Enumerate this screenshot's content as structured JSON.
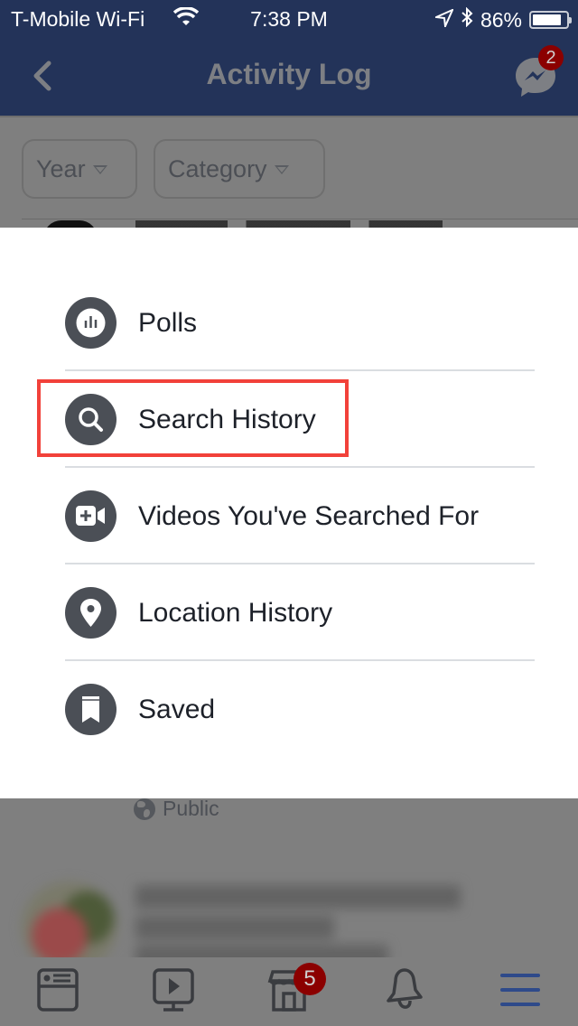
{
  "status_bar": {
    "carrier": "T-Mobile Wi-Fi",
    "time": "7:38 PM",
    "battery": "86%",
    "battery_level": 0.86,
    "icons": [
      "wifi-icon",
      "location-arrow-icon",
      "bluetooth-icon",
      "battery-icon"
    ]
  },
  "navbar": {
    "back_icon": "chevron-left-icon",
    "title": "Activity Log",
    "messenger_icon": "messenger-icon",
    "messenger_badge": "2"
  },
  "filters": {
    "year_label": "Year",
    "category_label": "Category"
  },
  "background_content": {
    "privacy_label": "Public"
  },
  "menu": {
    "items": [
      {
        "label": "Polls",
        "icon": "poll-icon"
      },
      {
        "label": "Search History",
        "icon": "search-icon",
        "highlighted": true
      },
      {
        "label": "Videos You've Searched For",
        "icon": "video-add-icon"
      },
      {
        "label": "Location History",
        "icon": "location-pin-icon"
      },
      {
        "label": "Saved",
        "icon": "bookmark-icon"
      }
    ],
    "highlight_color": "#f2413a"
  },
  "tabbar": {
    "tabs": [
      {
        "name": "news-feed",
        "icon": "news-feed-icon"
      },
      {
        "name": "watch",
        "icon": "video-play-icon"
      },
      {
        "name": "marketplace",
        "icon": "storefront-icon",
        "badge": "5"
      },
      {
        "name": "notifications",
        "icon": "bell-icon"
      },
      {
        "name": "menu",
        "icon": "hamburger-menu-icon",
        "active": true
      }
    ]
  },
  "colors": {
    "header_bg": "#233359",
    "dim_overlay": "#7f7f7f",
    "icon_circle": "#4b4f56",
    "badge_red": "#8b0000",
    "active_tab": "#2e4a8a"
  }
}
